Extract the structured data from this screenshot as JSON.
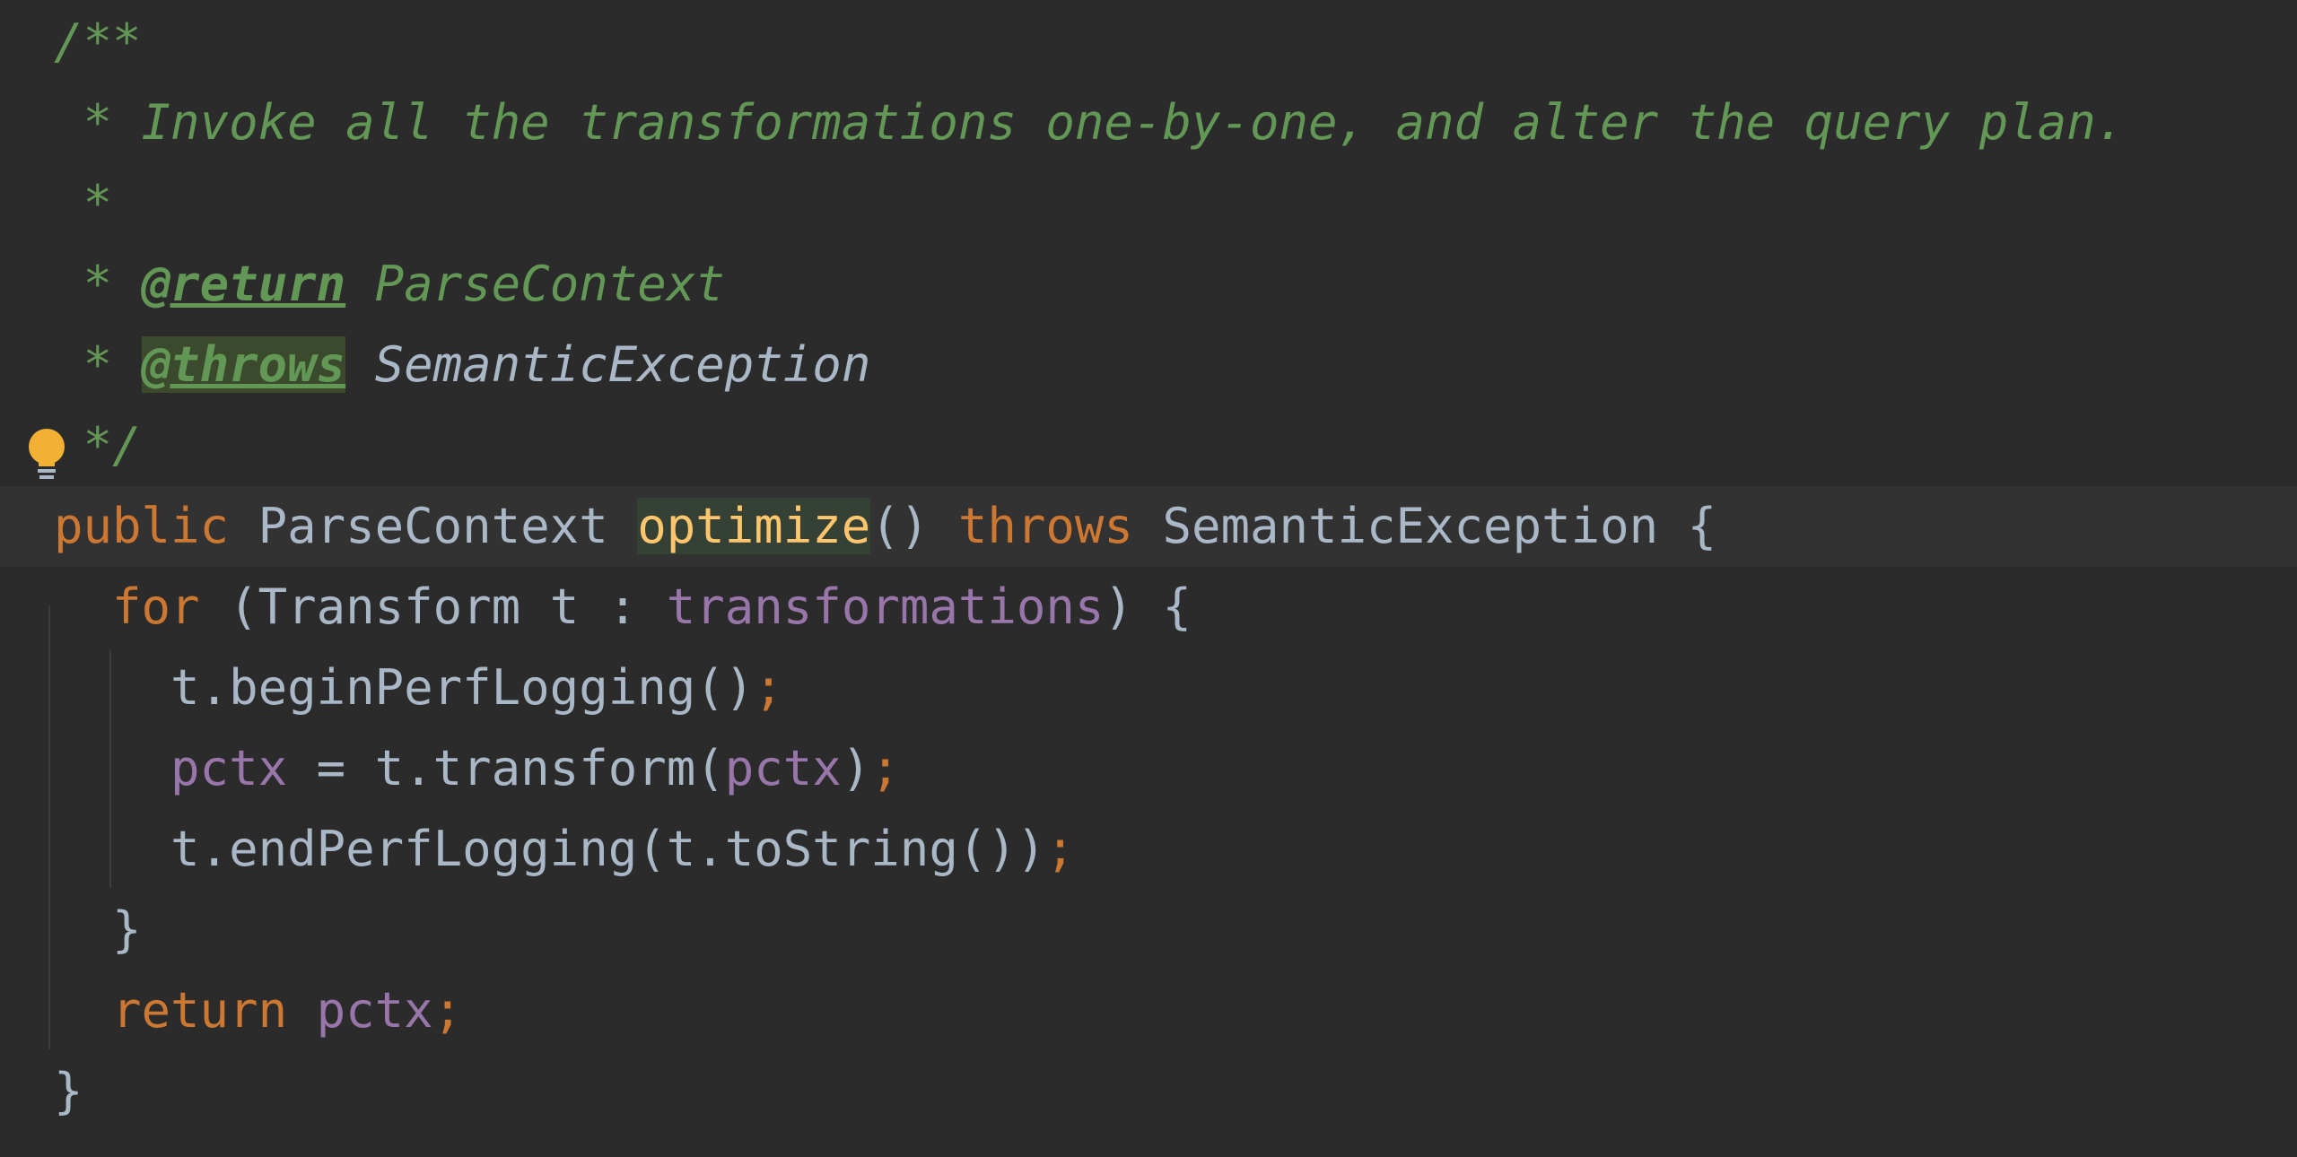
{
  "editor": {
    "lines": [
      {
        "parts": [
          {
            "t": "/**",
            "c": "comment"
          }
        ]
      },
      {
        "parts": [
          {
            "t": " * Invoke all the transformations one-by-one, and alter the query plan.",
            "c": "comment"
          }
        ]
      },
      {
        "parts": [
          {
            "t": " *",
            "c": "comment"
          }
        ]
      },
      {
        "parts": [
          {
            "t": " * ",
            "c": "comment"
          },
          {
            "t": "@return",
            "c": "tag"
          },
          {
            "t": " ParseContext",
            "c": "comment"
          }
        ]
      },
      {
        "parts": [
          {
            "t": " * ",
            "c": "comment"
          },
          {
            "t": "@throws",
            "c": "tag tag-hl"
          },
          {
            "t": " ",
            "c": "comment"
          },
          {
            "t": "SemanticException",
            "c": "comment-ref"
          }
        ]
      },
      {
        "parts": [
          {
            "t": " */",
            "c": "comment"
          }
        ]
      },
      {
        "current": true,
        "parts": [
          {
            "t": "public ",
            "c": "kw"
          },
          {
            "t": "ParseContext ",
            "c": "plain"
          },
          {
            "t": "optimize",
            "c": "method-decl"
          },
          {
            "t": "() ",
            "c": "plain"
          },
          {
            "t": "throws ",
            "c": "kw"
          },
          {
            "t": "SemanticException {",
            "c": "plain"
          }
        ]
      },
      {
        "parts": [
          {
            "t": "  for ",
            "c": "kw"
          },
          {
            "t": "(Transform t : ",
            "c": "plain"
          },
          {
            "t": "transformations",
            "c": "field"
          },
          {
            "t": ") {",
            "c": "plain"
          }
        ]
      },
      {
        "parts": [
          {
            "t": "    t.beginPerfLogging()",
            "c": "plain"
          },
          {
            "t": ";",
            "c": "punct"
          }
        ]
      },
      {
        "parts": [
          {
            "t": "    ",
            "c": "plain"
          },
          {
            "t": "pctx",
            "c": "field"
          },
          {
            "t": " = t.transform(",
            "c": "plain"
          },
          {
            "t": "pctx",
            "c": "field"
          },
          {
            "t": ")",
            "c": "plain"
          },
          {
            "t": ";",
            "c": "punct"
          }
        ]
      },
      {
        "parts": [
          {
            "t": "    t.endPerfLogging(t.toString())",
            "c": "plain"
          },
          {
            "t": ";",
            "c": "punct"
          }
        ]
      },
      {
        "parts": [
          {
            "t": "  }",
            "c": "plain"
          }
        ]
      },
      {
        "parts": [
          {
            "t": "  return ",
            "c": "kw"
          },
          {
            "t": "pctx",
            "c": "field"
          },
          {
            "t": ";",
            "c": "punct"
          }
        ]
      },
      {
        "parts": [
          {
            "t": "}",
            "c": "plain"
          }
        ]
      }
    ]
  },
  "icons": {
    "intention_bulb": "lightbulb-icon"
  },
  "colors": {
    "background": "#2b2b2b",
    "current_line": "#323232",
    "comment": "#629755",
    "keyword": "#cc7832",
    "field": "#9876aa",
    "method_declaration": "#ffc66d",
    "text": "#a9b7c6",
    "bulb": "#f2b134"
  }
}
